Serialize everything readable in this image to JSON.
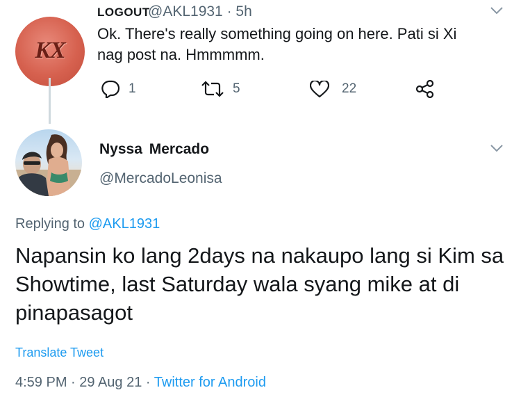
{
  "parent_tweet": {
    "display_name": "LOGOUT",
    "handle": "@AKL1931",
    "time": "· 5h",
    "avatar_text": "KX",
    "text": "Ok. There's really something going on here. Pati si Xi nag post na. Hmmmmm.",
    "actions": {
      "reply_count": "1",
      "retweet_count": "5",
      "like_count": "22"
    }
  },
  "reply_tweet": {
    "display_name": "Nyssa Mercado",
    "handle": "@MercadoLeonisa",
    "replying_prefix": "Replying to",
    "replying_to": "@AKL1931",
    "text": "Napansin ko lang 2days na nakaupo lang si Kim sa Showtime, last Saturday wala syang mike at di pinapasagot",
    "translate_label": "Translate Tweet",
    "timestamp": "4:59 PM · 29 Aug 21 ·",
    "source": "Twitter for Android"
  },
  "colors": {
    "accent": "#1d9bf0",
    "secondary_text": "#536471",
    "avatar1_bg": "#d6614f"
  },
  "icons": [
    "chevron-down-icon",
    "reply-icon",
    "retweet-icon",
    "like-icon",
    "share-icon"
  ]
}
